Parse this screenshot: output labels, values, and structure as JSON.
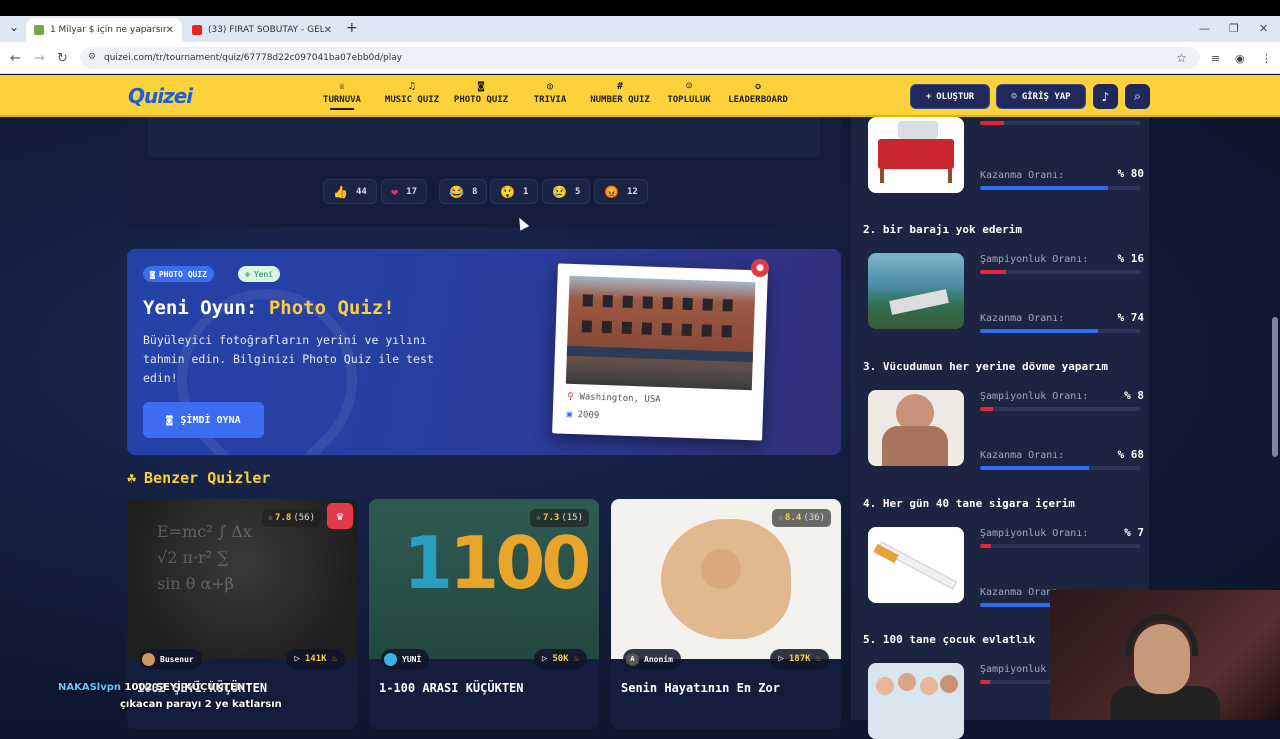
{
  "browser": {
    "tabs": [
      {
        "title": "1 Milyar $ için ne yaparsın? - Tu",
        "active": true
      },
      {
        "title": "(33) FIRAT SOBUTAY - GEL GÖR",
        "active": false
      }
    ],
    "url": "quizei.com/tr/tournament/quiz/67778d22c097041ba07ebb0d/play"
  },
  "header": {
    "logo": "Quizei",
    "nav": [
      {
        "label": "TURNUVA",
        "icon": "trophy-icon",
        "active": true
      },
      {
        "label": "MUSIC QUIZ",
        "icon": "music-icon",
        "active": false
      },
      {
        "label": "PHOTO QUIZ",
        "icon": "camera-icon",
        "active": false
      },
      {
        "label": "TRIVIA",
        "icon": "chat-icon",
        "active": false
      },
      {
        "label": "NUMBER QUIZ",
        "icon": "hash-icon",
        "active": false
      },
      {
        "label": "TOPLULUK",
        "icon": "users-icon",
        "active": false
      },
      {
        "label": "LEADERBOARD",
        "icon": "award-icon",
        "active": false
      }
    ],
    "create_label": "OLUŞTUR",
    "login_label": "GİRİŞ YAP"
  },
  "reactions": [
    {
      "emoji": "👍",
      "count": "44"
    },
    {
      "emoji": "❤",
      "count": "17"
    },
    {
      "emoji": "😂",
      "count": "8"
    },
    {
      "emoji": "😲",
      "count": "1"
    },
    {
      "emoji": "😢",
      "count": "5"
    },
    {
      "emoji": "😡",
      "count": "12"
    }
  ],
  "promo": {
    "badge_type": "PHOTO QUIZ",
    "badge_new": "Yeni",
    "title_prefix": "Yeni Oyun:",
    "title_highlight": "Photo Quiz!",
    "description": "Büyüleyici fotoğrafların yerini ve yılını tahmin edin. Bilginizi Photo Quiz ile test edin!",
    "play_label": "ŞİMDİ OYNA",
    "photo_location": "Washington, USA",
    "photo_year": "2009"
  },
  "similar": {
    "heading": "Benzer Quizler",
    "cards": [
      {
        "rating": "7.8",
        "count": "(56)",
        "author": "Busenur",
        "plays": "141K",
        "title": "1002 ŞEYİ KÜÇÜKTEN",
        "crown": true
      },
      {
        "rating": "7.3",
        "count": "(15)",
        "author": "YUNİ",
        "plays": "50K",
        "title": "1-100 ARASI KÜÇÜKTEN",
        "crown": false
      },
      {
        "rating": "8.4",
        "count": "(36)",
        "author": "Anonim",
        "plays": "187K",
        "title": "Senin Hayatının En Zor",
        "crown": false
      }
    ]
  },
  "ranking": {
    "win_rate_label": "Kazanma Oranı:",
    "champ_rate_label": "Şampiyonluk Oranı:",
    "items": [
      {
        "rank": "",
        "title": "",
        "champ": "",
        "champ_pct": 15,
        "win": "80",
        "win_pct": 80
      },
      {
        "rank": "2.",
        "title": "bir barajı yok ederim",
        "champ": "16",
        "champ_pct": 16,
        "win": "74",
        "win_pct": 74
      },
      {
        "rank": "3.",
        "title": "Vücudumun her yerine dövme yaparım",
        "champ": "8",
        "champ_pct": 8,
        "win": "68",
        "win_pct": 68
      },
      {
        "rank": "4.",
        "title": "Her gün 40 tane sigara içerim",
        "champ": "7",
        "champ_pct": 7,
        "win": "60",
        "win_pct": 60
      },
      {
        "rank": "5.",
        "title": "100 tane çocuk evlatlık",
        "champ": "",
        "champ_pct": 6,
        "win": "",
        "win_pct": 0
      }
    ]
  },
  "stream": {
    "ticker_name": "NAKASlvpn",
    "ticker_text": "1002 ŞEYİ KÜÇÜKTEN",
    "ticker_line2": "çıkacan parayı 2 ye katlarsın"
  }
}
